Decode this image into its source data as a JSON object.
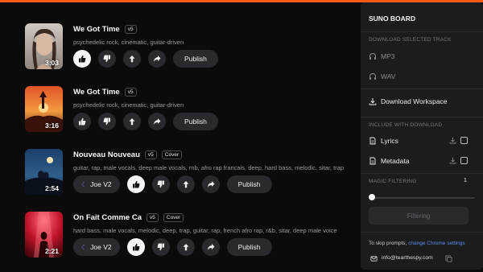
{
  "panel": {
    "title": "SUNO BOARD",
    "download_selected_label": "DOWNLOAD SELECTED TRACK",
    "mp3_label": "MP3",
    "wav_label": "WAV",
    "workspace_label": "Download Workspace",
    "include_label": "INCLUDE WITH DOWNLOAD",
    "lyrics_label": "Lyrics",
    "lyrics_checked": false,
    "metadata_label": "Metadata",
    "metadata_checked": false,
    "magic_label": "MAGIC FILTERING",
    "magic_value": "1",
    "filter_button": "Filtering",
    "skip_note": "To skip prompts, ",
    "skip_link": "change Chrome settings",
    "email": "info@tearthespy.com"
  },
  "tracks": [
    {
      "title": "We Got Time",
      "version": "v5",
      "duration": "3:03",
      "tags": "psychedelic rock, cinematic, guitar-driven",
      "liked": true,
      "publish": "Publish"
    },
    {
      "title": "We Got Time",
      "version": "v5",
      "duration": "3:16",
      "tags": "psychedelic rock, cinematic, guitar-driven",
      "liked": false,
      "publish": "Publish"
    },
    {
      "title": "Nouveau Nouveau",
      "version": "v5",
      "cover_badge": "Cover",
      "duration": "2:54",
      "tags": "guitar, rap, male vocals, deep male vocals, rnb, afro rap francais, deep, hard bass, melodic, sitar, trap",
      "model": "Joe V2",
      "liked": true,
      "publish": "Publish"
    },
    {
      "title": "On Fait Comme Ca",
      "version": "v5",
      "cover_badge": "Cover",
      "duration": "2:21",
      "tags": "hard bass, male vocals, melodic, deep, trap, guitar, rap, french afro rap, r&b, sitar, deep male voice",
      "model": "Joe V2",
      "liked": true,
      "publish": "Publish"
    }
  ],
  "colors": {
    "accent": "#ff5a12",
    "link": "#5d8de8",
    "model_icon": "#a279e8"
  },
  "icons": {
    "like": "thumbs-up-icon",
    "dislike": "thumbs-down-icon",
    "upload": "arrow-up-icon",
    "share": "share-icon",
    "model": "moon-icon"
  }
}
